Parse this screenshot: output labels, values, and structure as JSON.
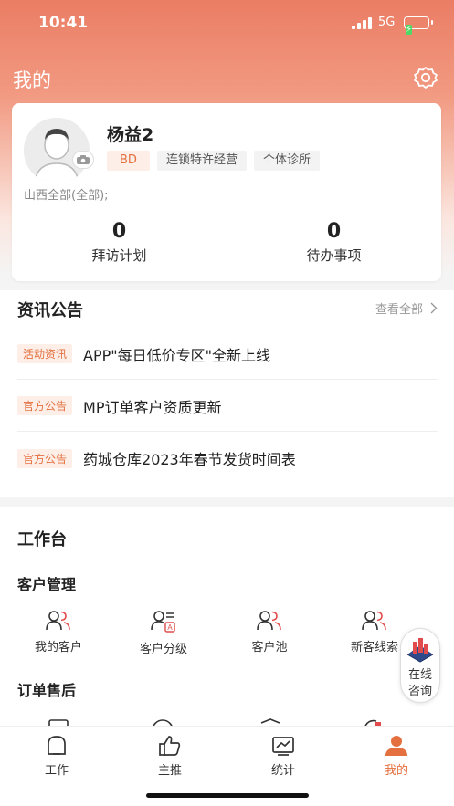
{
  "status_bar": {
    "time": "10:41",
    "network": "5G"
  },
  "header": {
    "title": "我的"
  },
  "profile": {
    "name": "杨益2",
    "tags": [
      "BD",
      "连锁特许经营",
      "个体诊所"
    ],
    "region": "山西全部(全部);",
    "stats": [
      {
        "value": "0",
        "label": "拜访计划"
      },
      {
        "value": "0",
        "label": "待办事项"
      }
    ]
  },
  "news": {
    "title": "资讯公告",
    "more_label": "查看全部",
    "items": [
      {
        "tag": "活动资讯",
        "text": "APP\"每日低价专区\"全新上线"
      },
      {
        "tag": "官方公告",
        "text": "MP订单客户资质更新"
      },
      {
        "tag": "官方公告",
        "text": "药城仓库2023年春节发货时间表"
      }
    ]
  },
  "workbench": {
    "title": "工作台",
    "customer_group": {
      "title": "客户管理",
      "items": [
        {
          "label": "我的客户",
          "icon": "users-icon"
        },
        {
          "label": "客户分级",
          "icon": "customer-level-icon"
        },
        {
          "label": "客户池",
          "icon": "customer-pool-icon"
        },
        {
          "label": "新客线索",
          "icon": "new-lead-icon"
        }
      ]
    },
    "order_group": {
      "title": "订单售后"
    }
  },
  "float_button": {
    "line1": "在线",
    "line2": "咨询"
  },
  "tabbar": {
    "active": 3,
    "items": [
      {
        "label": "工作",
        "icon": "work-icon"
      },
      {
        "label": "主推",
        "icon": "thumbs-up-icon"
      },
      {
        "label": "统计",
        "icon": "chart-icon"
      },
      {
        "label": "我的",
        "icon": "user-icon"
      }
    ]
  },
  "colors": {
    "accent": "#e4703f",
    "header_gradient_top": "#ea7d64",
    "tag_bg": "#fdeee7"
  }
}
